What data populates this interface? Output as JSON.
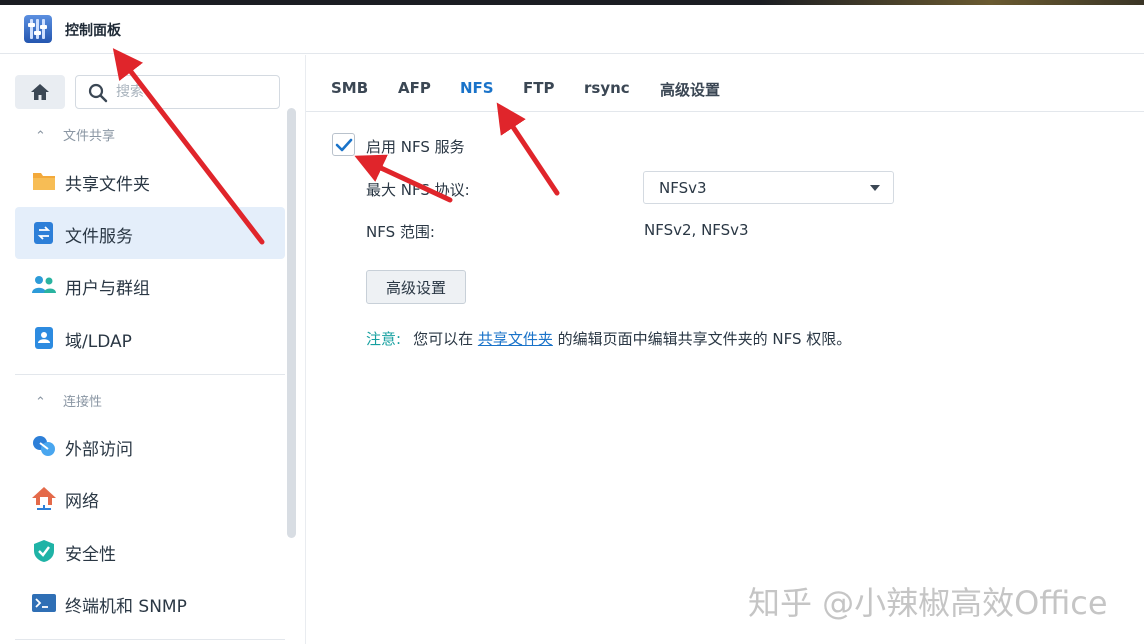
{
  "window": {
    "title": "控制面板"
  },
  "search": {
    "placeholder": "搜索"
  },
  "sidebar": {
    "sections": [
      {
        "header": "文件共享",
        "items": [
          "共享文件夹",
          "文件服务",
          "用户与群组",
          "域/LDAP"
        ]
      },
      {
        "header": "连接性",
        "items": [
          "外部访问",
          "网络",
          "安全性",
          "终端机和 SNMP"
        ]
      }
    ],
    "active_item": "文件服务"
  },
  "tabs": {
    "items": [
      "SMB",
      "AFP",
      "NFS",
      "FTP",
      "rsync",
      "高级设置"
    ],
    "active": "NFS"
  },
  "nfs": {
    "enable_label": "启用 NFS 服务",
    "enabled": true,
    "max_protocol_label": "最大 NFS 协议:",
    "max_protocol_value": "NFSv3",
    "range_label": "NFS 范围:",
    "range_value": "NFSv2, NFSv3",
    "advanced_button": "高级设置",
    "note_label": "注意:",
    "note_prefix": "您可以在",
    "note_link": "共享文件夹",
    "note_suffix": "的编辑页面中编辑共享文件夹的 NFS 权限。"
  },
  "watermark": "知乎 @小辣椒高效Office",
  "colors": {
    "accent": "#1a73c9",
    "active_bg": "#e4eefa",
    "annotation_arrow": "#e0252b",
    "note_label": "#16a0a0"
  }
}
